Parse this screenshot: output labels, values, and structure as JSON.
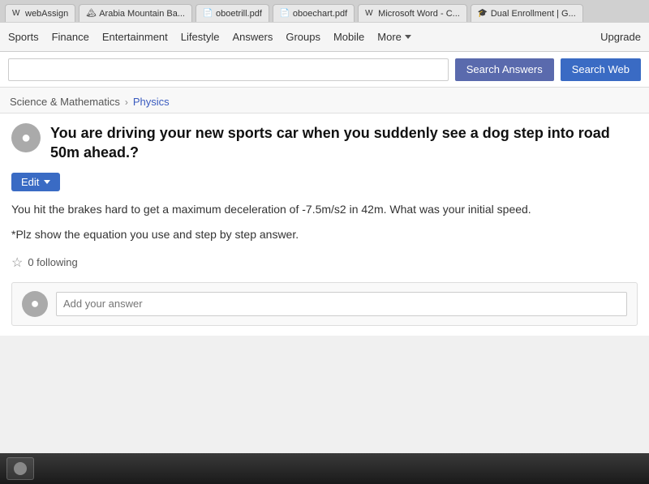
{
  "tabs": [
    {
      "label": "webAssign",
      "favicon": "W"
    },
    {
      "label": "Arabia Mountain Ba...",
      "favicon": "🏔"
    },
    {
      "label": "oboetrill.pdf",
      "favicon": "📄"
    },
    {
      "label": "oboechart.pdf",
      "favicon": "📄"
    },
    {
      "label": "Microsoft Word - C...",
      "favicon": "W"
    },
    {
      "label": "Dual Enrollment | G...",
      "favicon": "🎓"
    }
  ],
  "nav": {
    "items": [
      "Sports",
      "Finance",
      "Entertainment",
      "Lifestyle",
      "Answers",
      "Groups",
      "Mobile",
      "More",
      "Upgrade"
    ]
  },
  "search": {
    "placeholder": "",
    "btn_answers": "Search Answers",
    "btn_web": "Search Web"
  },
  "breadcrumb": {
    "parent": "Science & Mathematics",
    "current": "Physics"
  },
  "question": {
    "title": "You are driving your new sports car when you suddenly see a dog step into road 50m ahead.?",
    "edit_label": "Edit",
    "body": "You hit the brakes hard to get a maximum deceleration of -7.5m/s2 in 42m. What was your initial speed.",
    "note": "*Plz show the equation you use and step by step answer.",
    "following_count": "0 following"
  },
  "answer": {
    "placeholder": "Add your answer"
  },
  "colors": {
    "accent_blue": "#3a6bc4",
    "btn_search": "#5a6aad",
    "breadcrumb_link": "#3a5bbf"
  }
}
